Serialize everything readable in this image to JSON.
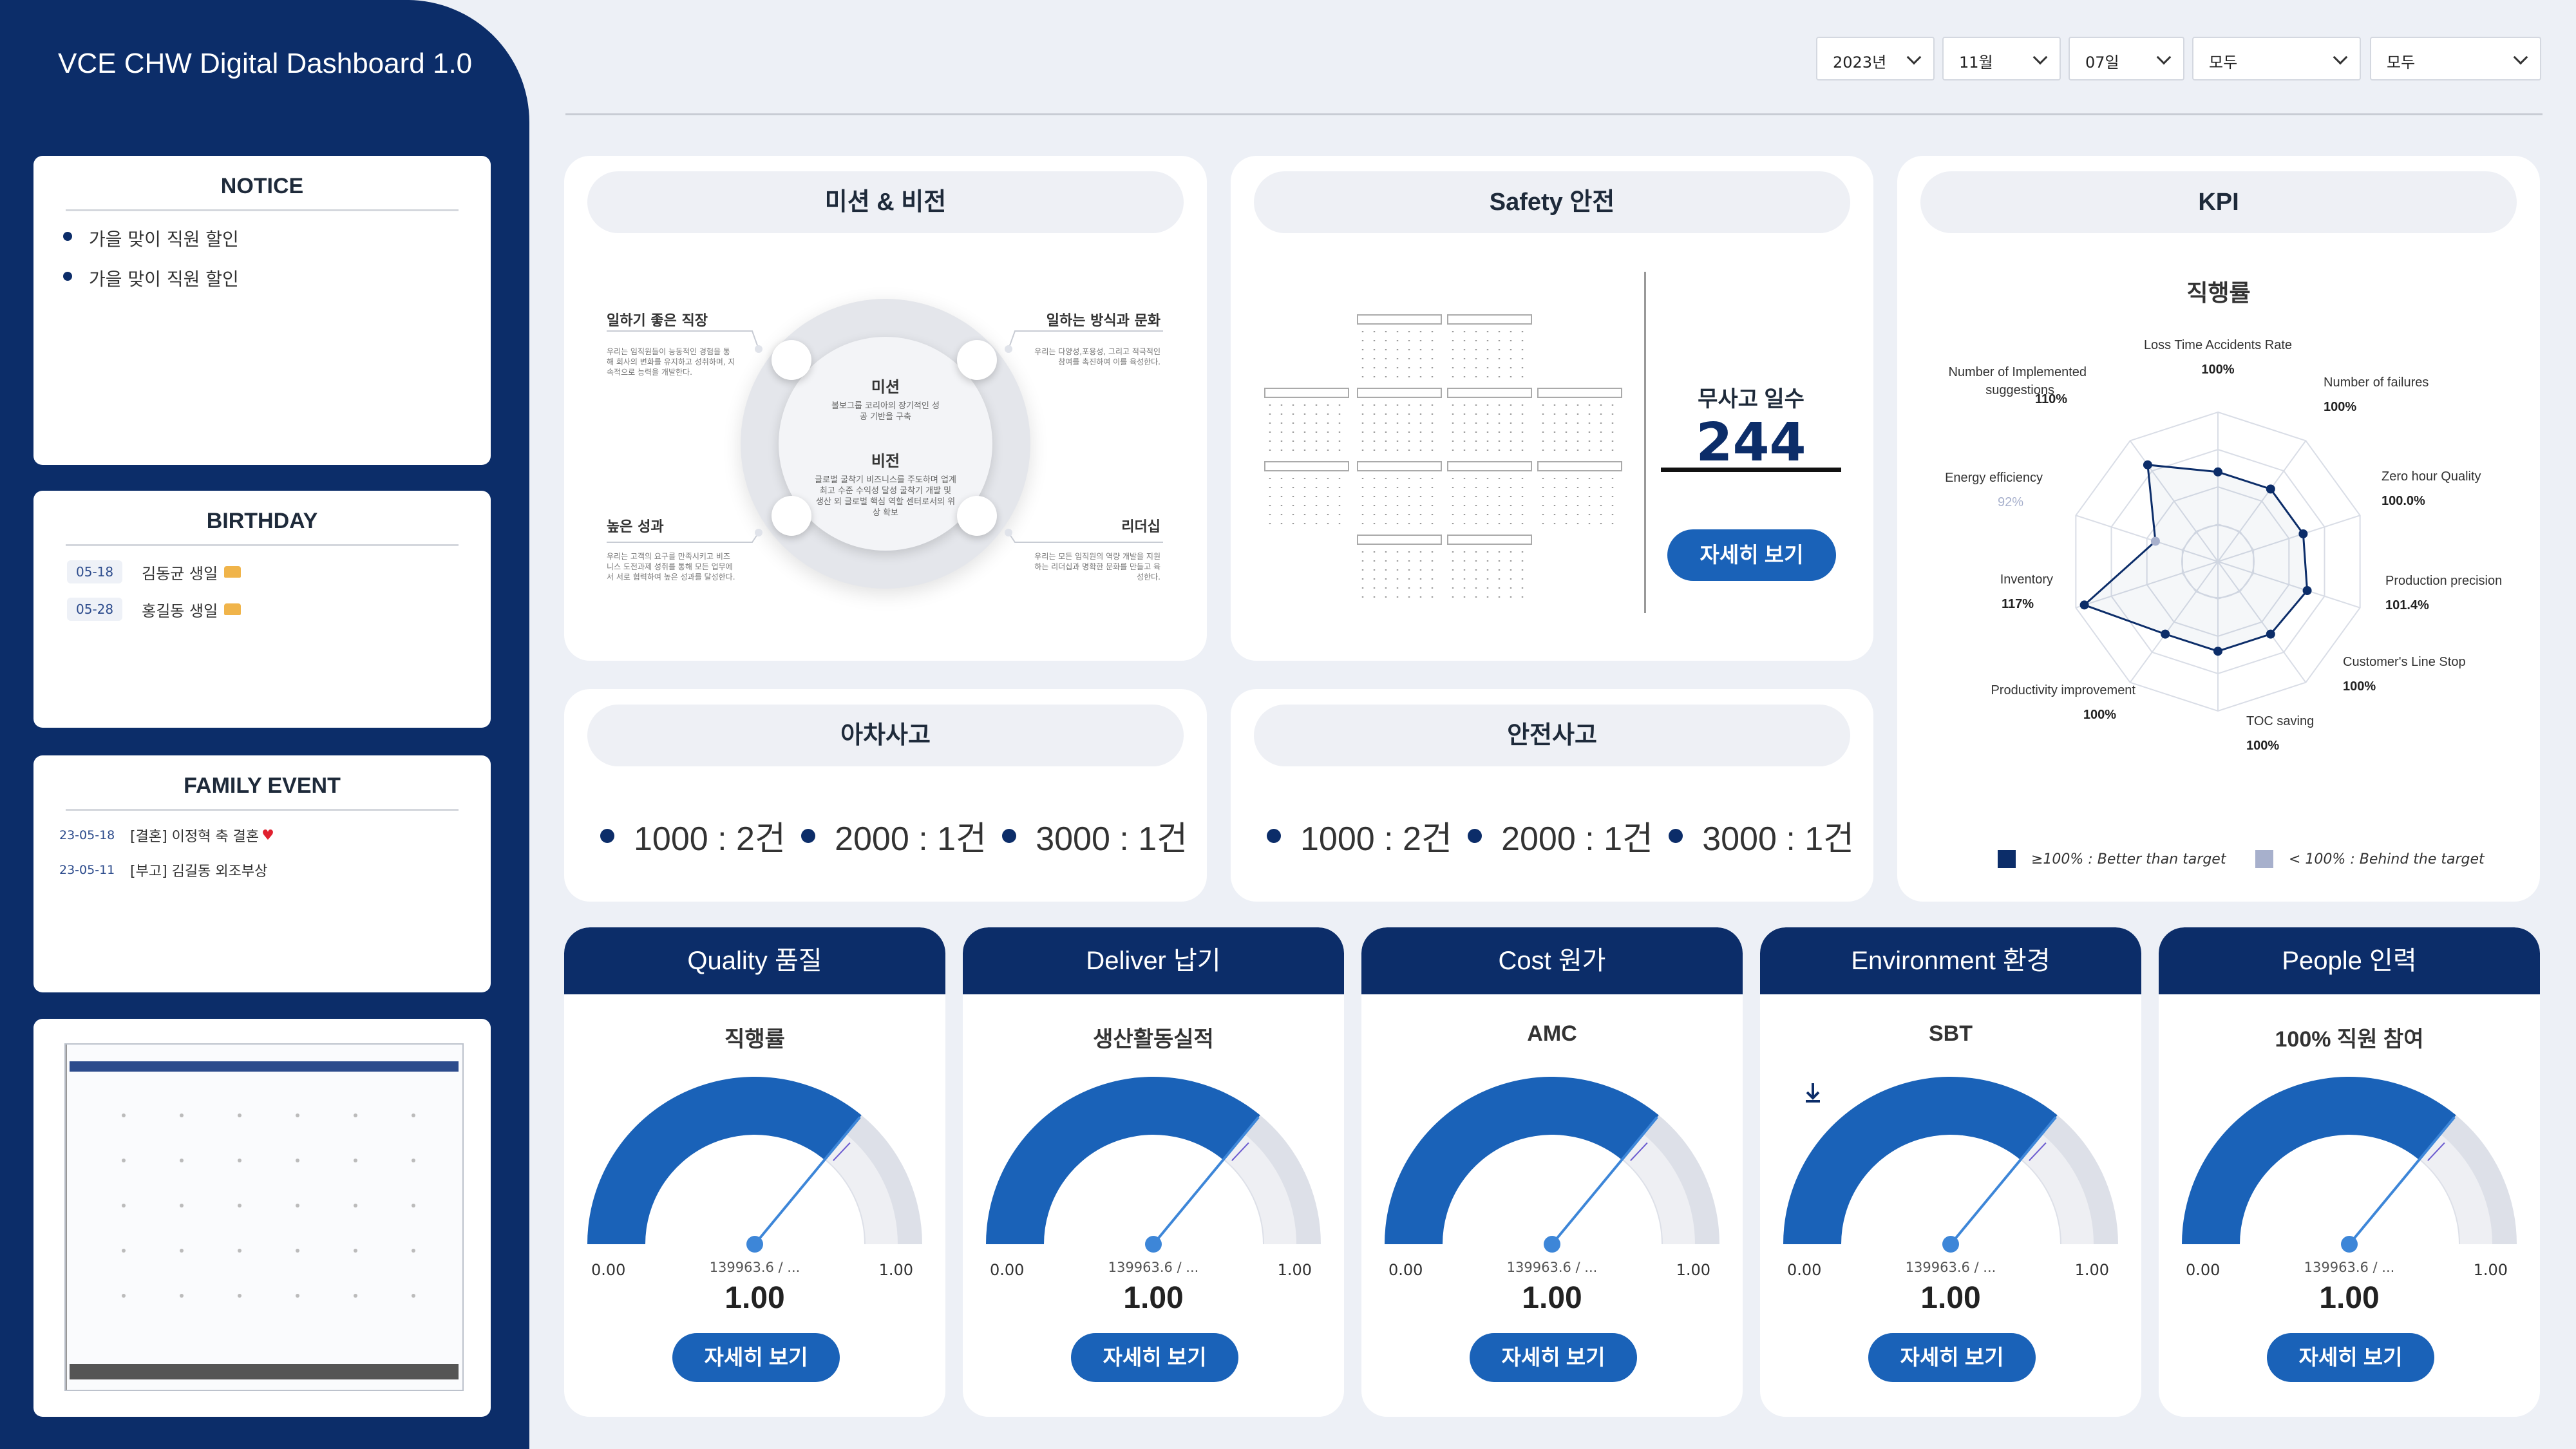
{
  "app": {
    "title": "VCE CHW Digital Dashboard 1.0"
  },
  "filters": {
    "year": "2023년",
    "month": "11월",
    "day": "07일",
    "filter1": "모두",
    "filter2": "모두"
  },
  "notice": {
    "title": "NOTICE",
    "items": [
      "가을 맞이 직원 할인",
      "가을 맞이 직원 할인"
    ]
  },
  "birthday": {
    "title": "BIRTHDAY",
    "items": [
      {
        "date": "05-18",
        "text": "김동균 생일"
      },
      {
        "date": "05-28",
        "text": "홍길동 생일"
      }
    ]
  },
  "family_event": {
    "title": "FAMILY EVENT",
    "items": [
      {
        "date": "23-05-18",
        "text": "[결혼] 이정혁 축 결혼"
      },
      {
        "date": "23-05-11",
        "text": "[부고] 김길동 외조부상"
      }
    ]
  },
  "mission": {
    "title": "미션 & 비전",
    "center_mission_title": "미션",
    "center_mission_text": "볼보그룹 코리아의 장기적인 성공 기반을 구축",
    "center_vision_title": "비전",
    "center_vision_text": "글로벌 굴착기 비즈니스를 주도하며 업계최고 수준 수익성 달성 굴착기 개발 및 생산 외 글로벌 핵심 역할 센터로서의 위상 확보",
    "tl_label": "일하기 좋은 직장",
    "tl_desc": "우리는 임직원들이 능동적인 경험을 통해 회사의 변화를 유지하고 성취하며, 지속적으로 능력을 개발한다.",
    "tr_label": "일하는 방식과 문화",
    "tr_desc": "우리는 다양성,포용성, 그리고 적극적인 참여를 촉진하여 이를 육성한다.",
    "bl_label": "높은 성과",
    "bl_desc": "우리는 고객의 요구를 만족시키고 비즈니스 도전과제 성취를 통해 모든 업무에서 서로 협력하여 높은 성과를 달성한다.",
    "br_label": "리더십",
    "br_desc": "우리는 모든 임직원의 역량 개발을 지원하는 리더십과 명확한 문화를 만들고 육성한다."
  },
  "safety": {
    "title": "Safety 안전",
    "no_accident_label": "무사고 일수",
    "no_accident_days": "244",
    "detail_button": "자세히 보기"
  },
  "kpi": {
    "title": "KPI",
    "chart_title": "직행률",
    "legend_better": "≥100% : Better than target",
    "legend_behind": "< 100% : Behind the target"
  },
  "chart_data": {
    "type": "radar",
    "title": "직행률",
    "categories": [
      "Loss Time Accidents Rate",
      "Number of failures",
      "Zero hour Quality",
      "Production precision",
      "Customer's Line Stop",
      "TOC saving",
      "Productivity improvement",
      "Inventory",
      "Energy efficiency",
      "Number of Implemented suggestions"
    ],
    "value_labels": [
      "100%",
      "100%",
      "100.0%",
      "101.4%",
      "100%",
      "100%",
      "100%",
      "117%",
      "92%",
      "110%"
    ],
    "values": [
      100,
      100,
      100.0,
      101.4,
      100,
      100,
      100,
      117,
      92,
      110
    ],
    "legend": [
      "≥100% : Better than target",
      "< 100% : Behind the target"
    ],
    "colors": {
      "better": "#0c2d69",
      "behind": "#a7b0cc"
    }
  },
  "nearmiss": {
    "title": "아차사고",
    "items": [
      "1000 : 2건",
      "2000 : 1건",
      "3000 : 1건"
    ]
  },
  "accident": {
    "title": "안전사고",
    "items": [
      "1000 : 2건",
      "2000 : 1건",
      "3000 : 1건"
    ]
  },
  "gauges": [
    {
      "header": "Quality 품질",
      "title": "직행률",
      "min": "0.00",
      "max": "1.00",
      "mid": "139963.6 / ...",
      "value": "1.00",
      "fill": 0.72,
      "button": "자세히 보기",
      "icon": ""
    },
    {
      "header": "Deliver 납기",
      "title": "생산활동실적",
      "min": "0.00",
      "max": "1.00",
      "mid": "139963.6 / ...",
      "value": "1.00",
      "fill": 0.72,
      "button": "자세히 보기",
      "icon": "download-doc-icon"
    },
    {
      "header": "Cost 원가",
      "title": "AMC",
      "min": "0.00",
      "max": "1.00",
      "mid": "139963.6 / ...",
      "value": "1.00",
      "fill": 0.72,
      "button": "자세히 보기",
      "icon": "download-icon"
    },
    {
      "header": "Environment 환경",
      "title": "SBT",
      "min": "0.00",
      "max": "1.00",
      "mid": "139963.6 / ...",
      "value": "1.00",
      "fill": 0.72,
      "button": "자세히 보기",
      "icon": "download-circle-icon"
    },
    {
      "header": "People 인력",
      "title": "100% 직원 참여",
      "min": "0.00",
      "max": "1.00",
      "mid": "139963.6 / ...",
      "value": "1.00",
      "fill": 0.72,
      "button": "자세히 보기",
      "icon": ""
    }
  ],
  "colors": {
    "navy": "#0c2d69",
    "accent": "#1a62b8",
    "gauge_track": "#dde0e8"
  }
}
